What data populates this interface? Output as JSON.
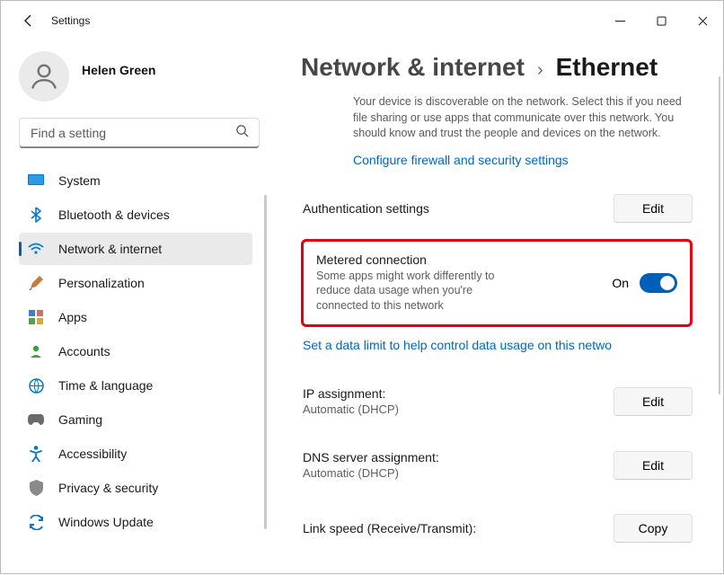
{
  "window": {
    "title": "Settings"
  },
  "user": {
    "name": "Helen Green"
  },
  "search": {
    "placeholder": "Find a setting"
  },
  "sidebar": {
    "items": [
      {
        "label": "System"
      },
      {
        "label": "Bluetooth & devices"
      },
      {
        "label": "Network & internet"
      },
      {
        "label": "Personalization"
      },
      {
        "label": "Apps"
      },
      {
        "label": "Accounts"
      },
      {
        "label": "Time & language"
      },
      {
        "label": "Gaming"
      },
      {
        "label": "Accessibility"
      },
      {
        "label": "Privacy & security"
      },
      {
        "label": "Windows Update"
      }
    ]
  },
  "breadcrumb": {
    "parent": "Network & internet",
    "current": "Ethernet"
  },
  "main": {
    "profile_desc": "Your device is discoverable on the network. Select this if you need file sharing or use apps that communicate over this network. You should know and trust the people and devices on the network.",
    "firewall_link": "Configure firewall and security settings",
    "auth": {
      "label": "Authentication settings",
      "button": "Edit"
    },
    "metered": {
      "title": "Metered connection",
      "desc": "Some apps might work differently to reduce data usage when you're connected to this network",
      "state": "On"
    },
    "data_limit_link": "Set a data limit to help control data usage on this netwo",
    "ip": {
      "label": "IP assignment:",
      "value": "Automatic (DHCP)",
      "button": "Edit"
    },
    "dns": {
      "label": "DNS server assignment:",
      "value": "Automatic (DHCP)",
      "button": "Edit"
    },
    "link_speed": {
      "label": "Link speed (Receive/Transmit):",
      "button": "Copy"
    }
  }
}
